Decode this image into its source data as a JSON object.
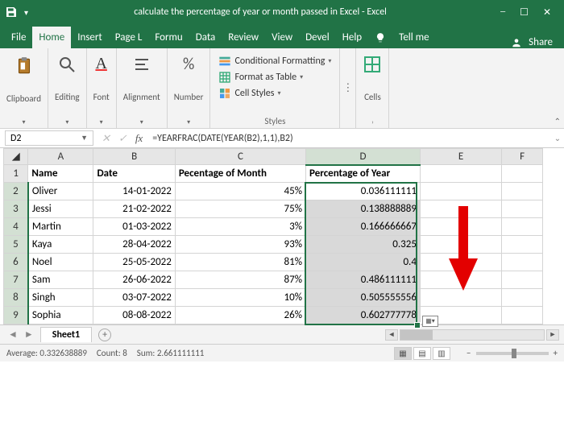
{
  "titlebar": {
    "title": "calculate the percentage of year or month passed in Excel  -  Excel"
  },
  "tabs": [
    "File",
    "Home",
    "Insert",
    "Page L",
    "Formu",
    "Data",
    "Review",
    "View",
    "Devel",
    "Help"
  ],
  "tabs_active_index": 1,
  "tellme": "Tell me",
  "share": "Share",
  "ribbon": {
    "groups_small": [
      {
        "name": "clipboard",
        "label": "Clipboard"
      },
      {
        "name": "editing",
        "label": "Editing"
      },
      {
        "name": "font",
        "label": "Font"
      },
      {
        "name": "alignment",
        "label": "Alignment"
      },
      {
        "name": "number",
        "label": "Number"
      }
    ],
    "styles": {
      "cond": "Conditional Formatting",
      "table": "Format as Table",
      "cellstyles": "Cell Styles",
      "label": "Styles"
    },
    "cells": "Cells"
  },
  "namebox": "D2",
  "formula": "=YEARFRAC(DATE(YEAR(B2),1,1),B2)",
  "columns": [
    "A",
    "B",
    "C",
    "D",
    "E",
    "F"
  ],
  "selected_col": "D",
  "selected_rows": [
    2,
    3,
    4,
    5,
    6,
    7,
    8,
    9
  ],
  "headers": {
    "A": "Name",
    "B": "Date",
    "C": "Pecentage of Month",
    "D": "Percentage of Year"
  },
  "rows": [
    {
      "n": 1
    },
    {
      "n": 2,
      "A": "Oliver",
      "B": "14-01-2022",
      "C": "45%",
      "D": "0.036111111"
    },
    {
      "n": 3,
      "A": "Jessi",
      "B": "21-02-2022",
      "C": "75%",
      "D": "0.138888889"
    },
    {
      "n": 4,
      "A": "Martin",
      "B": "01-03-2022",
      "C": "3%",
      "D": "0.166666667"
    },
    {
      "n": 5,
      "A": "Kaya",
      "B": "28-04-2022",
      "C": "93%",
      "D": "0.325"
    },
    {
      "n": 6,
      "A": "Noel",
      "B": "25-05-2022",
      "C": "81%",
      "D": "0.4"
    },
    {
      "n": 7,
      "A": "Sam",
      "B": "26-06-2022",
      "C": "87%",
      "D": "0.486111111"
    },
    {
      "n": 8,
      "A": "Singh",
      "B": "03-07-2022",
      "C": "10%",
      "D": "0.505555556"
    },
    {
      "n": 9,
      "A": "Sophia",
      "B": "08-08-2022",
      "C": "26%",
      "D": "0.602777778"
    }
  ],
  "sheet_tab": "Sheet1",
  "status": {
    "avg_label": "Average:",
    "avg": "0.332638889",
    "count_label": "Count:",
    "count": "8",
    "sum_label": "Sum:",
    "sum": "2.661111111",
    "zoom": "100%"
  }
}
